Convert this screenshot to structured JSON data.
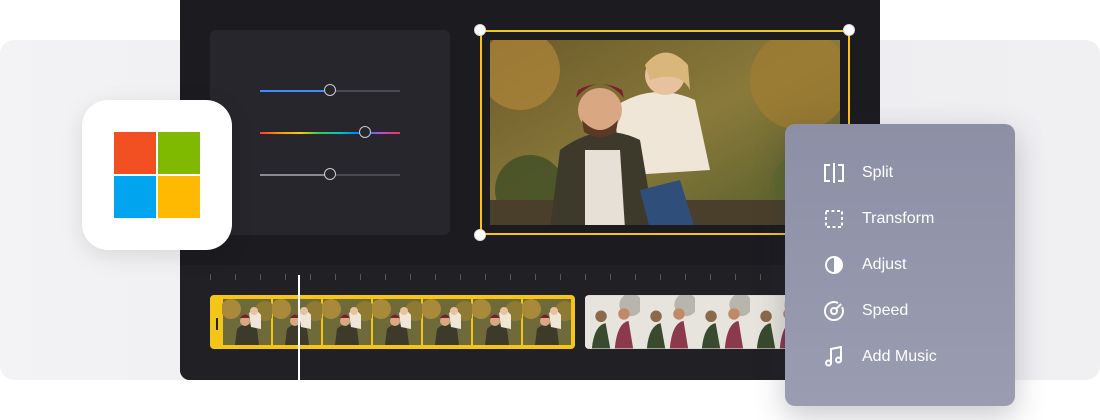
{
  "menu": {
    "items": [
      {
        "label": "Split",
        "icon": "split-icon"
      },
      {
        "label": "Transform",
        "icon": "transform-icon"
      },
      {
        "label": "Adjust",
        "icon": "adjust-icon"
      },
      {
        "label": "Speed",
        "icon": "speed-icon"
      },
      {
        "label": "Add Music",
        "icon": "music-note-icon"
      }
    ]
  },
  "adjust_panel": {
    "sliders": [
      {
        "name": "slider-blue",
        "value": 0.5,
        "color": "#3d8bff"
      },
      {
        "name": "slider-hue",
        "value": 0.75,
        "color": "rainbow"
      },
      {
        "name": "slider-gray",
        "value": 0.5,
        "color": "#8a8a93"
      }
    ]
  },
  "app_logo": {
    "icon": "windows-logo-icon",
    "colors": [
      "#f25022",
      "#7fba00",
      "#00a4ef",
      "#ffb900"
    ]
  },
  "colors": {
    "accent": "#f5c518",
    "editor_bg": "#1b1b20",
    "panel_bg": "#26262c",
    "menu_bg": "#9294ab"
  }
}
